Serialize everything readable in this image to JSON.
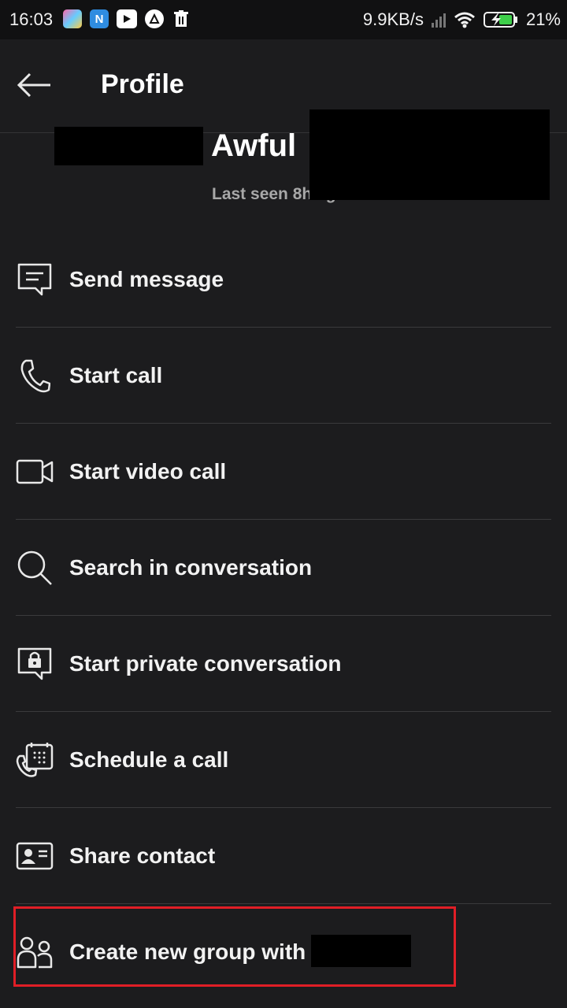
{
  "status_bar": {
    "time": "16:03",
    "network_speed": "9.9KB/s",
    "battery": "21%",
    "app_icons": [
      "app-icon-1",
      "app-icon-n",
      "youtube-icon",
      "triangle-icon",
      "trash-icon"
    ]
  },
  "header": {
    "title": "Profile"
  },
  "profile": {
    "name": "Awful",
    "last_seen": "Last seen 8h ago"
  },
  "menu": {
    "items": [
      {
        "label": "Send message",
        "icon": "message-icon"
      },
      {
        "label": "Start call",
        "icon": "phone-icon"
      },
      {
        "label": "Start video call",
        "icon": "video-icon"
      },
      {
        "label": "Search in conversation",
        "icon": "search-icon"
      },
      {
        "label": "Start private conversation",
        "icon": "lock-chat-icon"
      },
      {
        "label": "Schedule a call",
        "icon": "calendar-phone-icon"
      },
      {
        "label": "Share contact",
        "icon": "contact-card-icon"
      },
      {
        "label": "Create new group with",
        "icon": "group-icon"
      }
    ]
  },
  "colors": {
    "background": "#1c1c1e",
    "status_bar": "#111112",
    "highlight": "#e01e26",
    "text": "#f2f2f2",
    "muted": "#a8a8a8"
  }
}
